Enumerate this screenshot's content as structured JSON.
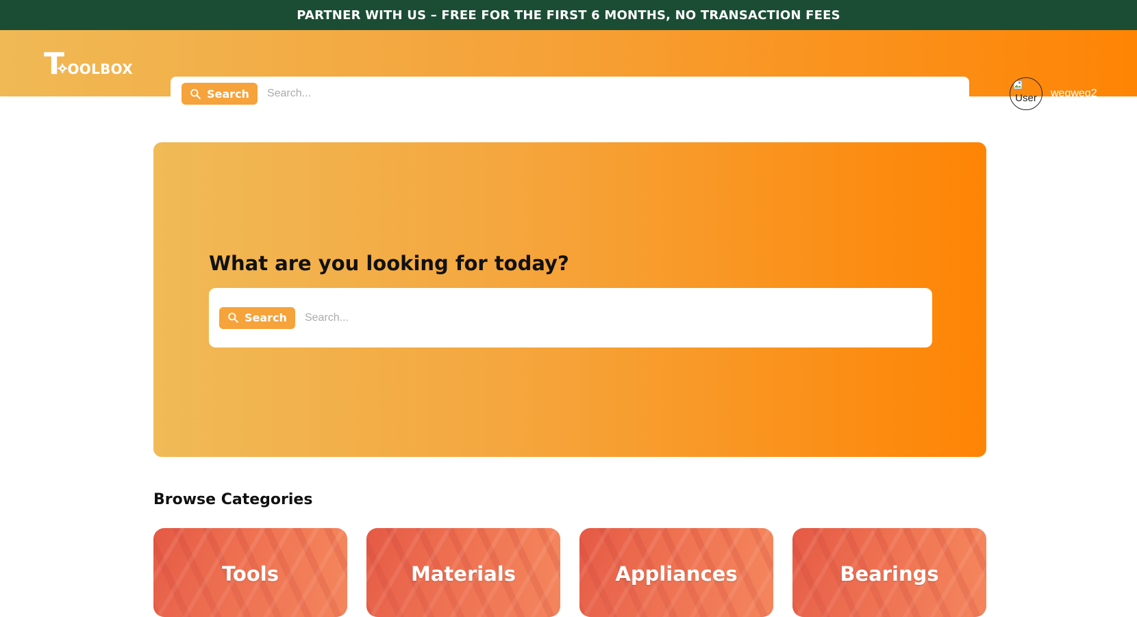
{
  "promo": {
    "text": "PARTNER WITH US – FREE FOR THE FIRST 6 MONTHS, NO TRANSACTION FEES"
  },
  "header": {
    "logo_text": "OOLBOX",
    "logo_letter": "T",
    "search": {
      "button_label": "Search",
      "placeholder": "Search..."
    },
    "user": {
      "avatar_alt": "User",
      "username": "weqweq2"
    }
  },
  "hero": {
    "title": "What are you looking for today?",
    "search": {
      "button_label": "Search",
      "placeholder": "Search..."
    }
  },
  "categories": {
    "title": "Browse Categories",
    "items": [
      {
        "label": "Tools"
      },
      {
        "label": "Materials"
      },
      {
        "label": "Appliances"
      },
      {
        "label": "Bearings"
      }
    ]
  },
  "colors": {
    "promo_bg": "#1b4d35",
    "accent": "#f5a33a",
    "gradient_start": "#f0b955",
    "gradient_end": "#fe8404"
  }
}
